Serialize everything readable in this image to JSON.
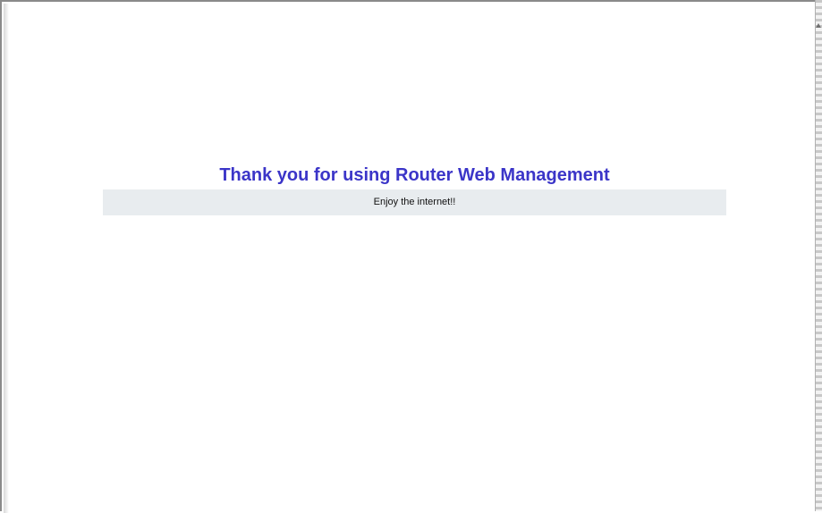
{
  "page": {
    "title": "Thank you for using Router Web Management",
    "message": "Enjoy the internet!!"
  },
  "colors": {
    "title": "#3b35c8",
    "message_background": "#e8ecef",
    "page_background": "#ffffff"
  },
  "icons": {
    "scroll_edge": "scrollbar-track",
    "scroll_arrow": "up-arrow-icon"
  }
}
